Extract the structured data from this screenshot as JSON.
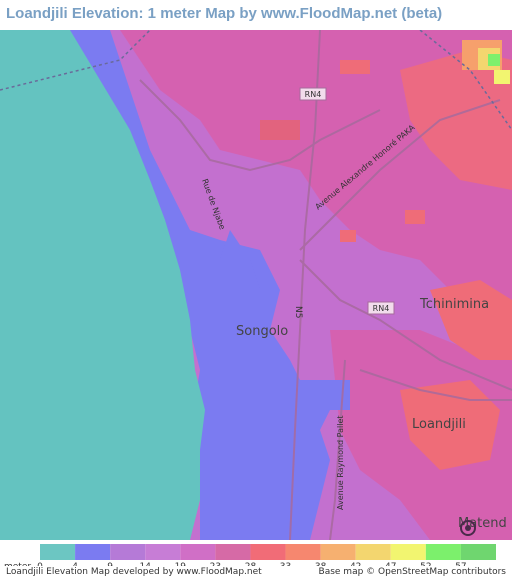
{
  "title": "Loandjili Elevation: 1 meter Map by www.FloodMap.net (beta)",
  "map": {
    "places": [
      {
        "name": "Songolo",
        "size": "large"
      },
      {
        "name": "Tchinimina",
        "size": "large"
      },
      {
        "name": "Loandjili",
        "size": "large"
      },
      {
        "name": "Matend",
        "size": "large"
      }
    ],
    "roads": [
      {
        "name": "RN4"
      },
      {
        "name": "RN4"
      },
      {
        "name": "N5"
      },
      {
        "name": "Rue de Njabe"
      },
      {
        "name": "Avenue Alexandre Honoré PAKA"
      },
      {
        "name": "Avenue Raymond Pallet"
      }
    ],
    "colors": {
      "sea": "#64c3c0",
      "lowland": "#7b7bf1",
      "mid": "#bd6fd7",
      "high": "#d35fa8",
      "higher": "#ec7096",
      "hot": "#f06d6d"
    }
  },
  "legend": {
    "unit": "meter",
    "stops": [
      {
        "label": "0",
        "color": "#6cc6c2"
      },
      {
        "label": "4",
        "color": "#7b7bf1"
      },
      {
        "label": "9",
        "color": "#b57ad7"
      },
      {
        "label": "14",
        "color": "#c77dd6"
      },
      {
        "label": "19",
        "color": "#d06fc6"
      },
      {
        "label": "23",
        "color": "#d66aa6"
      },
      {
        "label": "28",
        "color": "#f16c77"
      },
      {
        "label": "33",
        "color": "#f6876f"
      },
      {
        "label": "38",
        "color": "#f6b070"
      },
      {
        "label": "42",
        "color": "#f3d66f"
      },
      {
        "label": "47",
        "color": "#f2f570"
      },
      {
        "label": "52",
        "color": "#7cf06c"
      },
      {
        "label": "57",
        "color": "#6fd66f"
      }
    ]
  },
  "footer": {
    "credit": "Loandjili Elevation Map developed by www.FloodMap.net",
    "basemap": "Base map © OpenStreetMap contributors"
  }
}
